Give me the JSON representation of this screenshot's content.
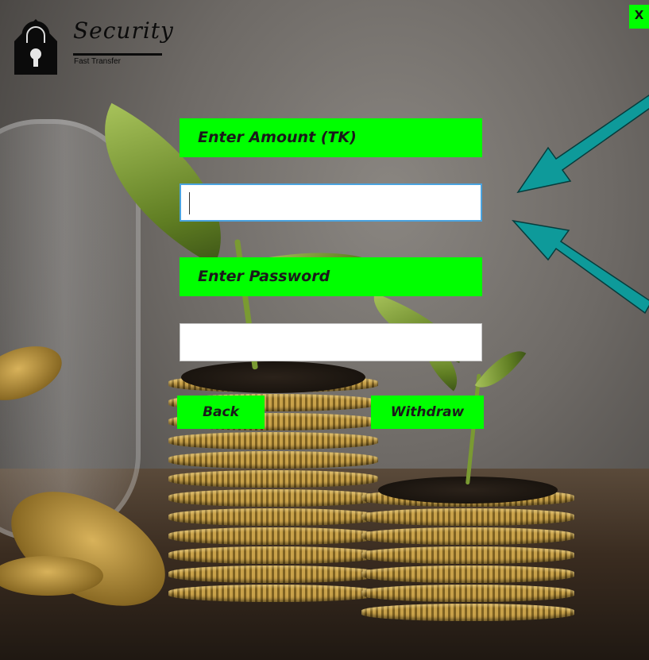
{
  "header": {
    "brand_title": "Security",
    "brand_subtitle": "Fast Transfer",
    "close_label": "X",
    "logo_icon": "house-padlock-icon"
  },
  "form": {
    "amount_label": "Enter Amount (TK)",
    "amount_value": "",
    "password_label": "Enter Password",
    "password_value": ""
  },
  "actions": {
    "back_label": "Back",
    "withdraw_label": "Withdraw"
  },
  "colors": {
    "accent_green": "#00ff00",
    "arrow_teal": "#0e9a9a"
  }
}
